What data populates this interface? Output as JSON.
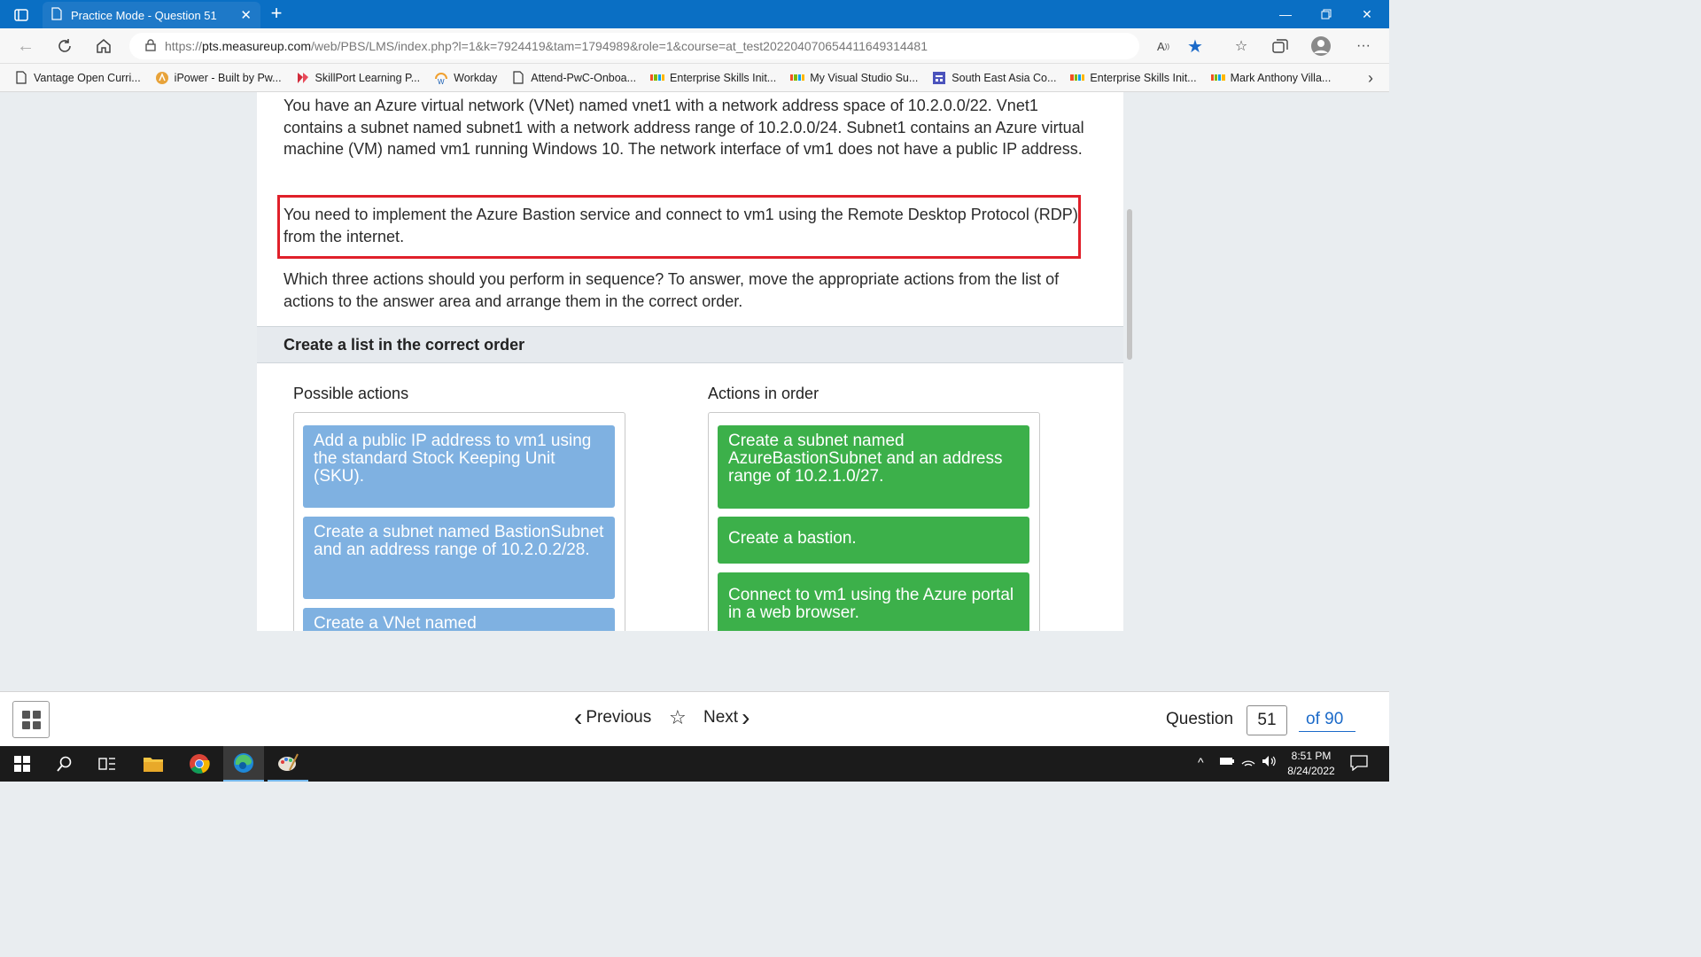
{
  "browser": {
    "tab_title": "Practice Mode - Question 51",
    "url_prefix": "https://",
    "url_host": "pts.measureup.com",
    "url_path": "/web/PBS/LMS/index.php?l=1&k=7924419&tam=1794989&role=1&course=at_test20220407065441164931448​1"
  },
  "bookmarks": [
    {
      "label": "Vantage Open Curri...",
      "icon": "document-icon"
    },
    {
      "label": "iPower - Built by Pw...",
      "icon": "ipower-icon"
    },
    {
      "label": "SkillPort Learning P...",
      "icon": "skillport-icon"
    },
    {
      "label": "Workday",
      "icon": "workday-icon"
    },
    {
      "label": "Attend-PwC-Onboa...",
      "icon": "document-icon"
    },
    {
      "label": "Enterprise Skills Init...",
      "icon": "microsoft-icon"
    },
    {
      "label": "My Visual Studio Su...",
      "icon": "microsoft-icon"
    },
    {
      "label": "South East Asia Co...",
      "icon": "teams-icon"
    },
    {
      "label": "Enterprise Skills Init...",
      "icon": "microsoft-icon"
    },
    {
      "label": "Mark Anthony Villa...",
      "icon": "microsoft-icon"
    }
  ],
  "question": {
    "paragraph1": "You have an Azure virtual network (VNet) named vnet1 with a network address space of 10.2.0.0/22. Vnet1 contains a subnet named subnet1 with a network address range of 10.2.0.0/24. Subnet1 contains an Azure virtual machine (VM) named vm1 running Windows 10. The network interface of vm1 does not have a public IP address.",
    "paragraph2": "You need to implement the Azure Bastion service and connect to vm1 using the Remote Desktop Protocol (RDP) from the internet.",
    "paragraph3": "Which three actions should you perform in sequence? To answer, move the appropriate actions from the list of actions to the answer area and arrange them in the correct order."
  },
  "task": {
    "banner": "Create a list in the correct order",
    "possible_title": "Possible actions",
    "order_title": "Actions in order",
    "possible_actions": [
      "Add a public IP address to vm1 using the standard Stock Keeping Unit (SKU).",
      "Create a subnet named BastionSubnet and an address range of 10.2.0.2/28.",
      "Create a VNet named"
    ],
    "ordered_actions": [
      "Create a subnet named AzureBastionSubnet and an address range of 10.2.1.0/27.",
      "Create a bastion.",
      "Connect to vm1 using the Azure portal in a web browser."
    ]
  },
  "footer": {
    "previous_label": "Previous",
    "next_label": "Next",
    "question_label": "Question",
    "question_number": "51",
    "total_label": "of 90"
  },
  "taskbar": {
    "time": "8:51 PM",
    "date": "8/24/2022"
  },
  "colors": {
    "highlight_border": "#e0202a",
    "possible_item": "#7fb1e1",
    "ordered_item": "#3cb04a",
    "titlebar": "#0a6fc4",
    "link": "#1b6ac9"
  }
}
